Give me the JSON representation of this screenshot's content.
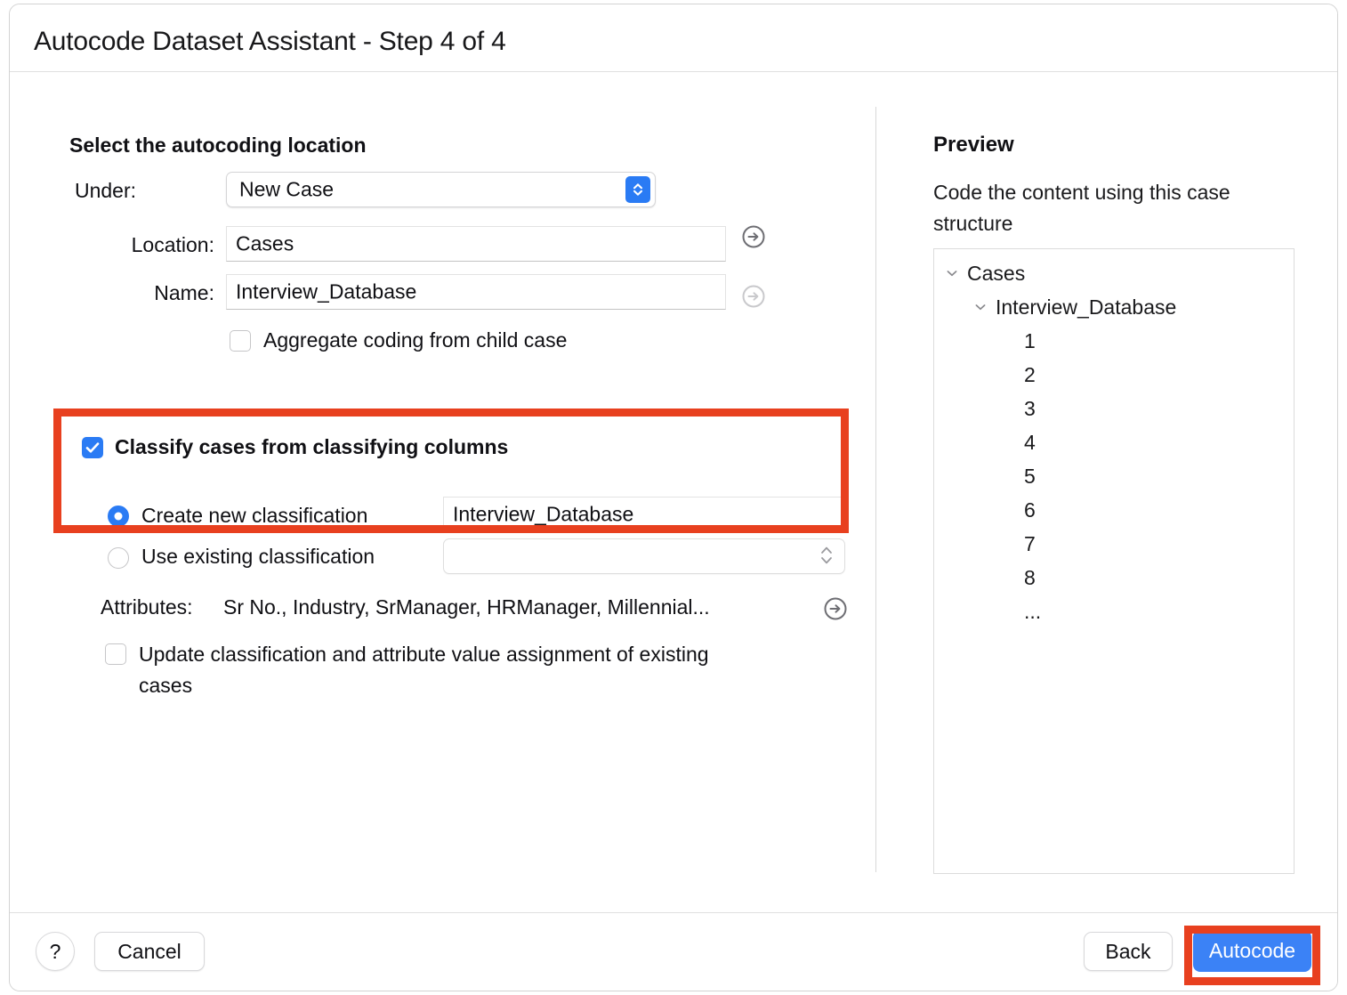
{
  "window": {
    "title": "Autocode Dataset Assistant - Step 4 of 4"
  },
  "left": {
    "section_heading": "Select the autocoding location",
    "under": {
      "label": "Under:",
      "value": "New Case",
      "icon": "chevron-up-down-icon"
    },
    "location": {
      "label": "Location:",
      "value": "Cases",
      "go_icon": "arrow-right-circle-icon"
    },
    "name": {
      "label": "Name:",
      "value": "Interview_Database",
      "go_icon": "arrow-right-circle-icon"
    },
    "aggregate_checkbox": {
      "label": "Aggregate coding from child case",
      "checked": false
    },
    "classify_checkbox": {
      "label": "Classify cases from classifying columns",
      "checked": true
    },
    "create_new_radio": {
      "label": "Create new classification",
      "selected": true,
      "value": "Interview_Database"
    },
    "use_existing_radio": {
      "label": "Use existing classification",
      "selected": false,
      "value": "",
      "icon": "chevron-up-down-icon"
    },
    "attributes": {
      "label": "Attributes:",
      "value": "Sr No., Industry, SrManager, HRManager, Millennial...",
      "go_icon": "arrow-right-circle-icon"
    },
    "update_checkbox": {
      "label": "Update classification and attribute value assignment of existing cases",
      "checked": false
    }
  },
  "preview": {
    "title": "Preview",
    "subtitle": "Code the content using this case structure",
    "tree": [
      {
        "label": "Cases",
        "depth": 0,
        "chevron": "chevron-down-icon"
      },
      {
        "label": "Interview_Database",
        "depth": 1,
        "chevron": "chevron-down-icon"
      },
      {
        "label": "1",
        "depth": 2,
        "chevron": ""
      },
      {
        "label": "2",
        "depth": 2,
        "chevron": ""
      },
      {
        "label": "3",
        "depth": 2,
        "chevron": ""
      },
      {
        "label": "4",
        "depth": 2,
        "chevron": ""
      },
      {
        "label": "5",
        "depth": 2,
        "chevron": ""
      },
      {
        "label": "6",
        "depth": 2,
        "chevron": ""
      },
      {
        "label": "7",
        "depth": 2,
        "chevron": ""
      },
      {
        "label": "8",
        "depth": 2,
        "chevron": ""
      },
      {
        "label": "...",
        "depth": 2,
        "chevron": ""
      }
    ]
  },
  "footer": {
    "help_label": "?",
    "cancel_label": "Cancel",
    "back_label": "Back",
    "autocode_label": "Autocode"
  },
  "colors": {
    "accent_blue": "#2a7bf4",
    "primary_button_blue": "#3b82f6",
    "highlight_red": "#e8401f"
  }
}
